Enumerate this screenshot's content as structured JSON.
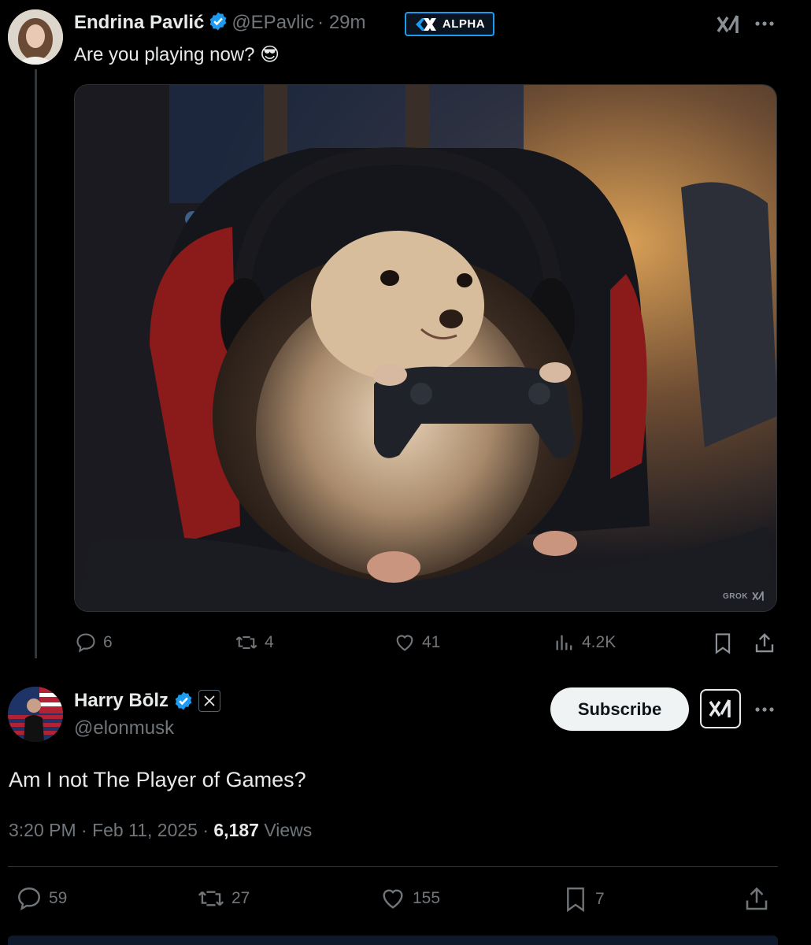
{
  "tweet": {
    "author_name": "Endrina Pavlić",
    "handle": "@EPavlic",
    "time": "· 29m",
    "badge_label": "ALPHA",
    "text": "Are you playing now? 😎",
    "image_watermark": "GROK",
    "actions": {
      "replies": "6",
      "retweets": "4",
      "likes": "41",
      "views": "4.2K"
    }
  },
  "reply": {
    "author_name": "Harry Bōlz",
    "handle": "@elonmusk",
    "subscribe_label": "Subscribe",
    "text": "Am I not The Player of Games?",
    "timestamp": "3:20 PM · Feb 11, 2025 ·",
    "views_count": "6,187",
    "views_label": "Views",
    "actions": {
      "replies": "59",
      "retweets": "27",
      "likes": "155",
      "bookmarks": "7"
    }
  },
  "colors": {
    "accent": "#1d9bf0",
    "text": "#e7e9ea",
    "muted": "#71767b",
    "background": "#000000"
  },
  "icons": [
    "verified-badge-icon",
    "x-logo-icon",
    "more-icon",
    "reply-icon",
    "retweet-icon",
    "like-icon",
    "views-icon",
    "bookmark-icon",
    "share-icon",
    "grok-icon"
  ]
}
